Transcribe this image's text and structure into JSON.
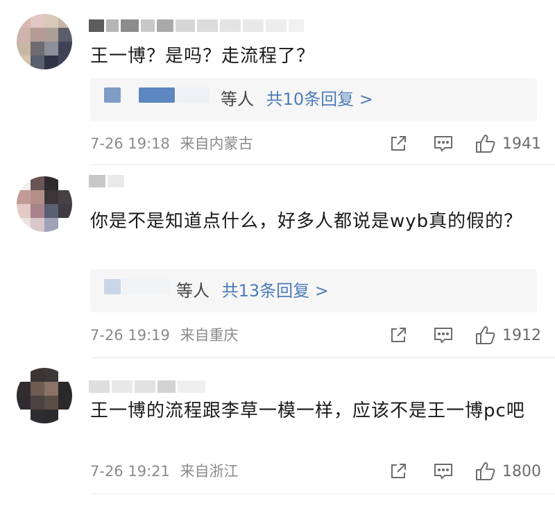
{
  "comments": [
    {
      "text": "王一博？是吗？走流程了？",
      "reply_prefix": "等人",
      "reply_count": "共10条回复 >",
      "date": "7-26 19:18",
      "location": "来自内蒙古",
      "likes": "1941"
    },
    {
      "text": "你是不是知道点什么，好多人都说是wyb真的假的？",
      "reply_prefix": "等人",
      "reply_count": "共13条回复 >",
      "date": "7-26 19:19",
      "location": "来自重庆",
      "likes": "1912"
    },
    {
      "text": "王一博的流程跟李草一模一样，应该不是王一博pc吧",
      "date": "7-26 19:21",
      "location": "来自浙江",
      "likes": "1800"
    }
  ],
  "icons": {
    "share": "share-icon",
    "comment": "comment-icon",
    "like": "thumbs-up-icon"
  },
  "colors": {
    "link": "#4c7bb8",
    "meta": "#8a8a8a",
    "reply_bg": "#f6f6f6"
  }
}
